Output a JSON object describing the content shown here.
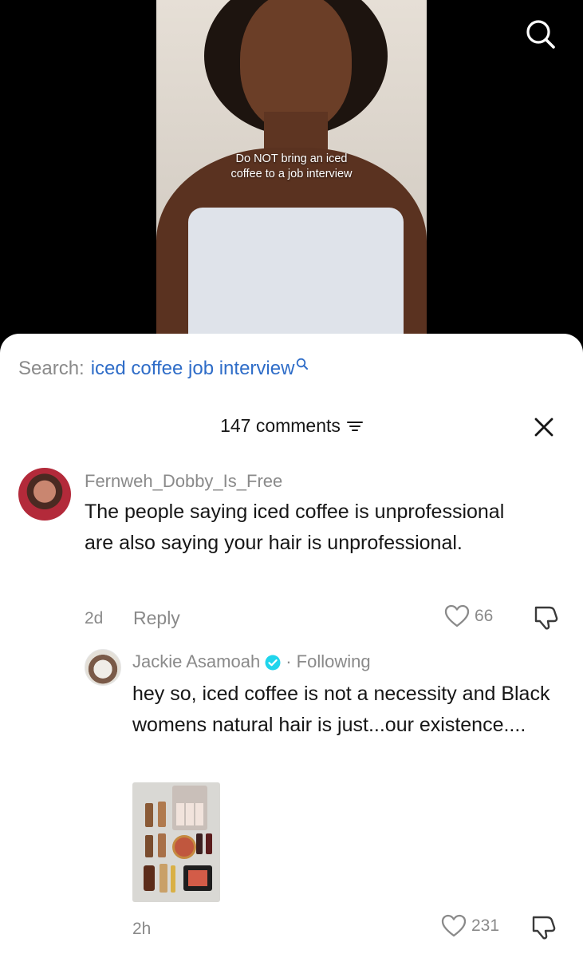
{
  "video": {
    "caption_line1": "Do NOT bring an iced",
    "caption_line2": "coffee to a job interview",
    "search_icon": "search-icon"
  },
  "search": {
    "label": "Search:",
    "term": "iced coffee job interview",
    "icon": "search-icon"
  },
  "comments_header": {
    "count_label": "147 comments",
    "sort_icon": "sort-icon",
    "close_icon": "close-icon"
  },
  "comments": [
    {
      "username": "Fernweh_Dobby_Is_Free",
      "text": "The people saying iced coffee is unprofessional are also saying your hair is unprofessional.",
      "age": "2d",
      "reply_label": "Reply",
      "likes": "66"
    },
    {
      "username": "Jackie Asamoah",
      "verified": true,
      "separator": "·",
      "relationship": "Following",
      "text": "hey so, iced coffee is not a necessity and Black womens natural hair is just...our existence....",
      "age": "2h",
      "likes": "231"
    }
  ],
  "colors": {
    "link_blue": "#2f6dc8",
    "verified_cyan": "#20d5ec",
    "muted_gray": "#8a8a8a"
  }
}
